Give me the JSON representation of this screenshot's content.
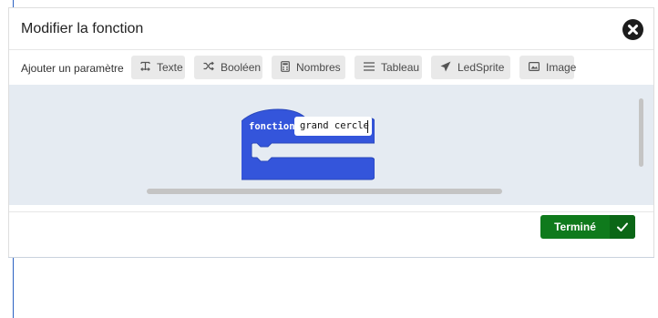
{
  "dialog": {
    "title": "Modifier la fonction",
    "close_icon": "close-circle-icon"
  },
  "param_bar": {
    "label": "Ajouter un paramètre",
    "buttons": [
      {
        "label": "Texte",
        "icon": "text-icon"
      },
      {
        "label": "Booléen",
        "icon": "shuffle-icon"
      },
      {
        "label": "Nombres",
        "icon": "calculator-icon"
      },
      {
        "label": "Tableau",
        "icon": "list-icon"
      },
      {
        "label": "LedSprite",
        "icon": "paper-plane-icon"
      },
      {
        "label": "Image",
        "icon": "image-icon"
      }
    ]
  },
  "workspace": {
    "block_keyword": "fonction",
    "function_name": "grand cercle",
    "block_color": "#3455db"
  },
  "footer": {
    "done_label": "Terminé",
    "done_icon": "checkmark-icon",
    "done_color": "#0f7a1c"
  }
}
